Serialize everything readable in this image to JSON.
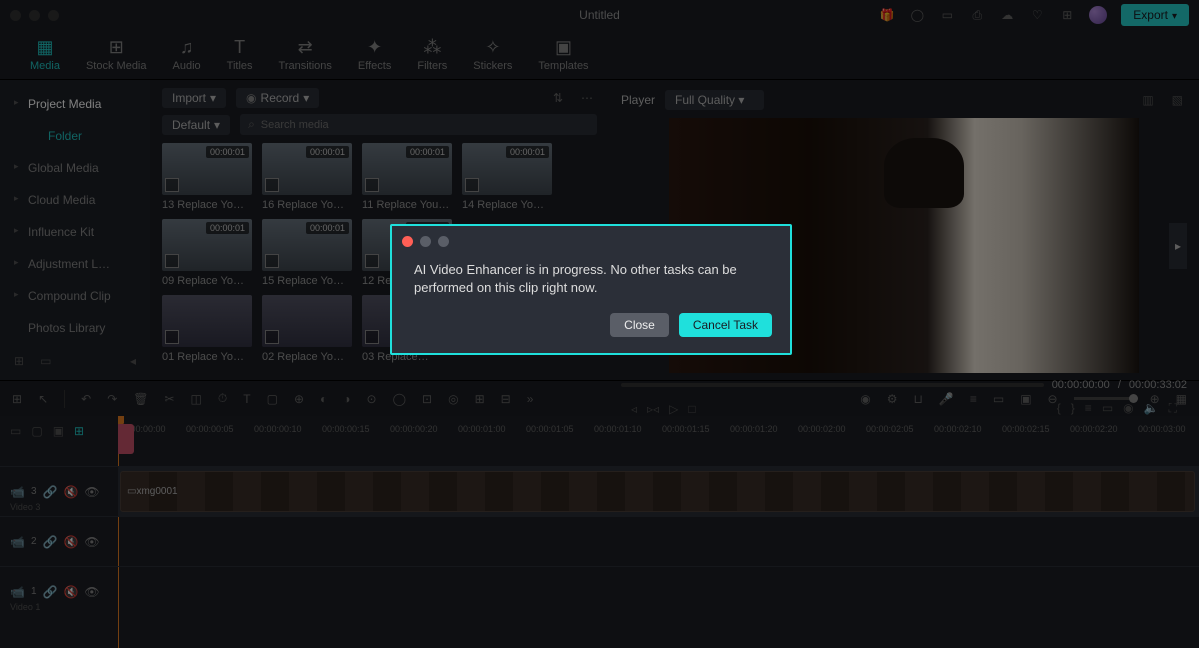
{
  "title": "Untitled",
  "export": "Export",
  "nav": [
    {
      "icon": "▦",
      "label": "Media"
    },
    {
      "icon": "⊞",
      "label": "Stock Media"
    },
    {
      "icon": "♫",
      "label": "Audio"
    },
    {
      "icon": "T",
      "label": "Titles"
    },
    {
      "icon": "⇄",
      "label": "Transitions"
    },
    {
      "icon": "✦",
      "label": "Effects"
    },
    {
      "icon": "⁂",
      "label": "Filters"
    },
    {
      "icon": "✧",
      "label": "Stickers"
    },
    {
      "icon": "▣",
      "label": "Templates"
    }
  ],
  "sidebar": {
    "items": [
      "Project Media",
      "Global Media",
      "Cloud Media",
      "Influence Kit",
      "Adjustment L…",
      "Compound Clip",
      "Photos Library"
    ],
    "sub": "Folder"
  },
  "controls": {
    "import": "Import",
    "record": "Record",
    "defaultSort": "Default",
    "searchPlaceholder": "Search media"
  },
  "thumbs": {
    "r1": [
      {
        "dur": "00:00:01",
        "label": "13 Replace Yo…"
      },
      {
        "dur": "00:00:01",
        "label": "16 Replace Yo…"
      },
      {
        "dur": "00:00:01",
        "label": "11 Replace You…"
      },
      {
        "dur": "00:00:01",
        "label": "14 Replace Yo…"
      }
    ],
    "r2": [
      {
        "dur": "00:00:01",
        "label": "09 Replace Yo…"
      },
      {
        "dur": "00:00:01",
        "label": "15 Replace Yo…"
      },
      {
        "dur": "00:00:01",
        "label": "12 Repla…"
      }
    ],
    "r3": [
      {
        "dur": "",
        "label": "01 Replace Yo…"
      },
      {
        "dur": "",
        "label": "02 Replace Yo…"
      },
      {
        "dur": "",
        "label": "03 Replace…"
      }
    ]
  },
  "preview": {
    "player": "Player",
    "quality": "Full Quality",
    "timeStart": "00:00:00:00",
    "timeSep": "/",
    "timeEnd": "00:00:33:02"
  },
  "ruler": [
    "00:00:00:00",
    "00:00:00:05",
    "00:00:00:10",
    "00:00:00:15",
    "00:00:00:20",
    "00:00:01:00",
    "00:00:01:05",
    "00:00:01:10",
    "00:00:01:15",
    "00:00:01:20",
    "00:00:02:00",
    "00:00:02:05",
    "00:00:02:10",
    "00:00:02:15",
    "00:00:02:20",
    "00:00:03:00"
  ],
  "tracks": {
    "v3": {
      "num": "3",
      "label": "Video 3",
      "clip": "xmg0001"
    },
    "v2": {
      "num": "2",
      "label": ""
    },
    "v1": {
      "num": "1",
      "label": "Video 1"
    }
  },
  "modal": {
    "message": "AI Video Enhancer is in progress. No other tasks can be performed on this clip right now.",
    "close": "Close",
    "cancel": "Cancel Task"
  }
}
